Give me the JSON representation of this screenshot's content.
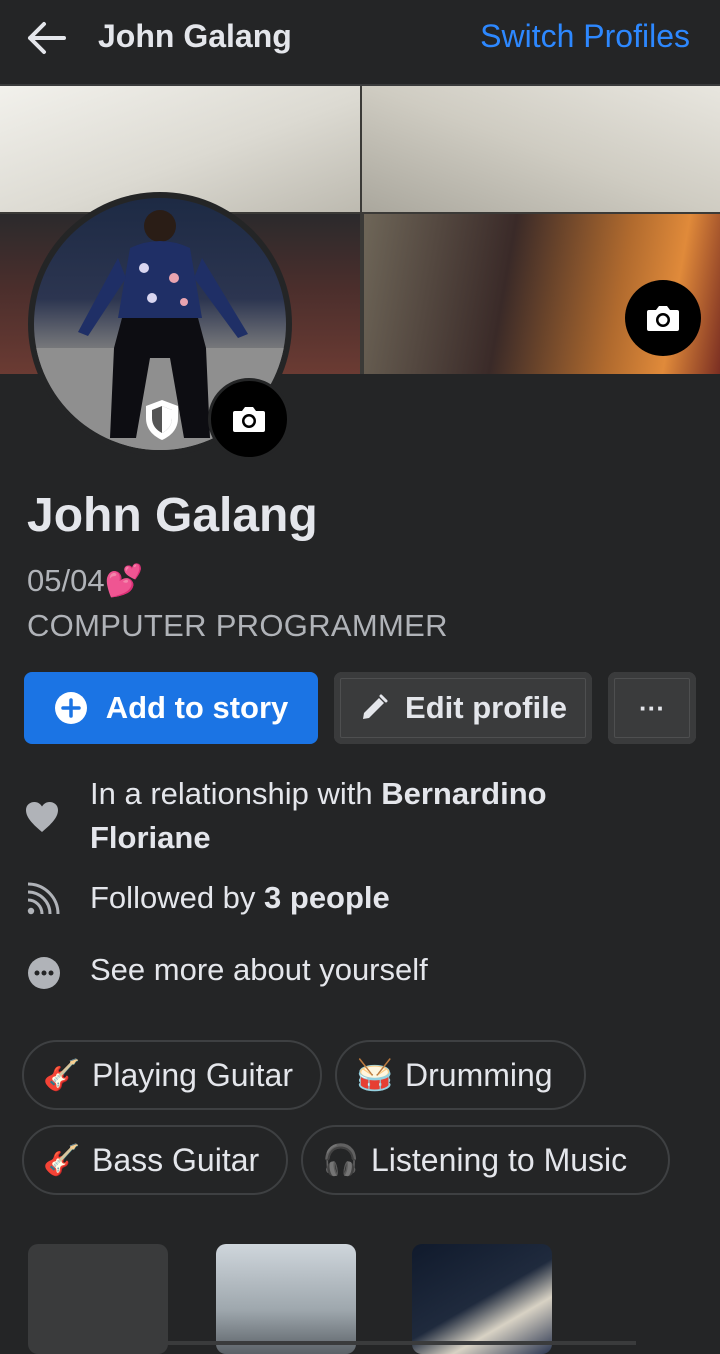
{
  "header": {
    "back_icon": "arrow-left-icon",
    "title": "John Galang",
    "switch_label": "Switch Profiles"
  },
  "profile": {
    "name": "John Galang",
    "bio_line1": "05/04💕",
    "bio_line2": "COMPUTER PROGRAMMER"
  },
  "actions": {
    "add_story_label": "Add to story",
    "edit_profile_label": "Edit profile",
    "more_label": "···"
  },
  "details": {
    "relationship_prefix": "In a relationship with ",
    "relationship_name_line1": "Bernardino",
    "relationship_name_line2": "Floriane",
    "followed_prefix": "Followed by ",
    "followed_count": "3 people",
    "see_more": "See more about yourself"
  },
  "hobbies": [
    {
      "emoji": "🎸",
      "label": "Playing Guitar"
    },
    {
      "emoji": "🥁",
      "label": "Drumming"
    },
    {
      "emoji": "🎸",
      "label": "Bass Guitar"
    },
    {
      "emoji": "🎧",
      "label": "Listening to Music"
    }
  ],
  "colors": {
    "background": "#242526",
    "accent": "#1b74e4",
    "link": "#2d88ff",
    "secondary_button": "#3a3b3c"
  }
}
